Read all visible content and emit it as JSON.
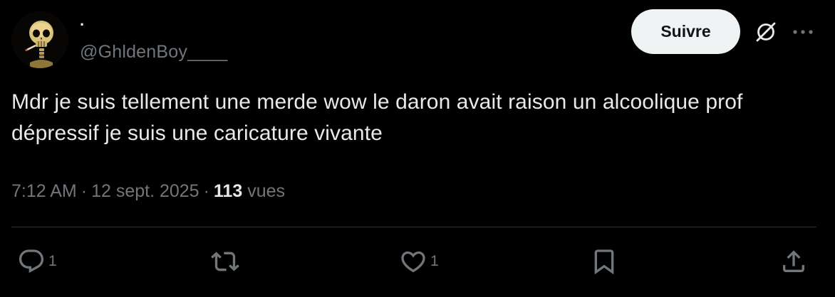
{
  "author": {
    "display_name": "·",
    "handle": "@GhldenBoy____"
  },
  "header": {
    "follow_label": "Suivre"
  },
  "tweet": {
    "text": "Mdr je suis tellement une merde wow le daron avait raison un alcoolique prof dépressif je suis une caricature vivante",
    "time": "7:12 AM",
    "date": "12 sept. 2025",
    "separator": "·",
    "views_count": "113",
    "views_label": "vues"
  },
  "actions": {
    "replies": "1",
    "retweets": "",
    "likes": "1"
  },
  "icons": {
    "avatar": "skull-avatar",
    "grok": "grok-icon",
    "more": "more-dots-icon",
    "reply": "reply-icon",
    "retweet": "retweet-icon",
    "like": "heart-icon",
    "bookmark": "bookmark-icon",
    "share": "share-icon"
  },
  "colors": {
    "background": "#000000",
    "text_primary": "#e7e9ea",
    "text_secondary": "#71767b",
    "follow_bg": "#eff3f4",
    "divider": "#2f3336"
  }
}
